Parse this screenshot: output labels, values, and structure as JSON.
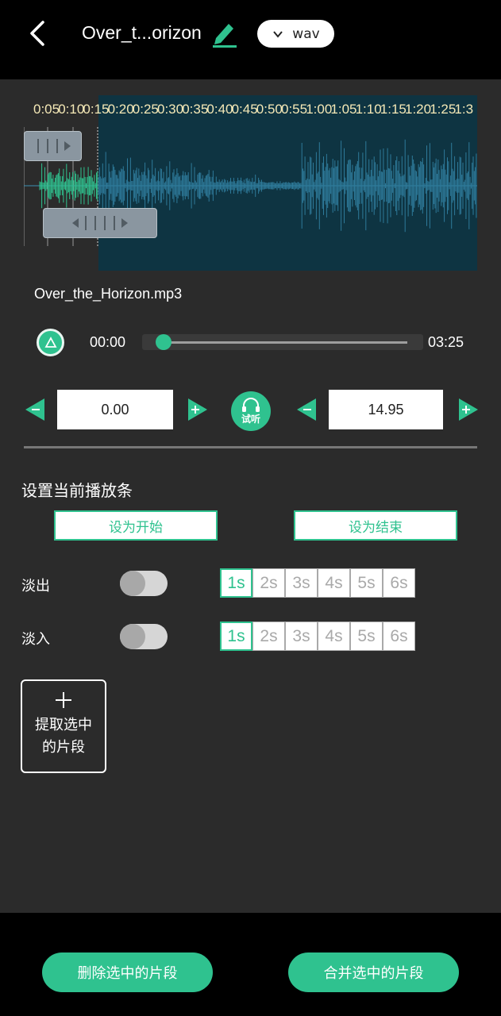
{
  "header": {
    "title": "Over_t...orizon",
    "format": "wav"
  },
  "waveform": {
    "ticks": [
      "0:05",
      "0:10",
      "0:15",
      "0:20",
      "0:25",
      "0:30",
      "0:35",
      "0:40",
      "0:45",
      "0:50",
      "0:55",
      "1:00",
      "1:05",
      "1:10",
      "1:15",
      "1:20",
      "1:25",
      "1:3"
    ]
  },
  "file": {
    "name": "Over_the_Horizon.mp3"
  },
  "player": {
    "current": "00:00",
    "total": "03:25",
    "progress": 0
  },
  "range": {
    "start": "0.00",
    "end": "14.95",
    "listen_label": "试听"
  },
  "settings": {
    "title": "设置当前播放条",
    "set_start": "设为开始",
    "set_end": "设为结束",
    "fade_out": "淡出",
    "fade_in": "淡入",
    "durations": [
      "1s",
      "2s",
      "3s",
      "4s",
      "5s",
      "6s"
    ]
  },
  "extract": {
    "label": "提取选中的片段"
  },
  "bottom": {
    "delete": "删除选中的片段",
    "merge": "合并选中的片段"
  },
  "colors": {
    "accent": "#2fc28f",
    "wave_bg": "#0e3442",
    "wave": "#2e7a9a",
    "selected_wave": "#2fc28f"
  }
}
